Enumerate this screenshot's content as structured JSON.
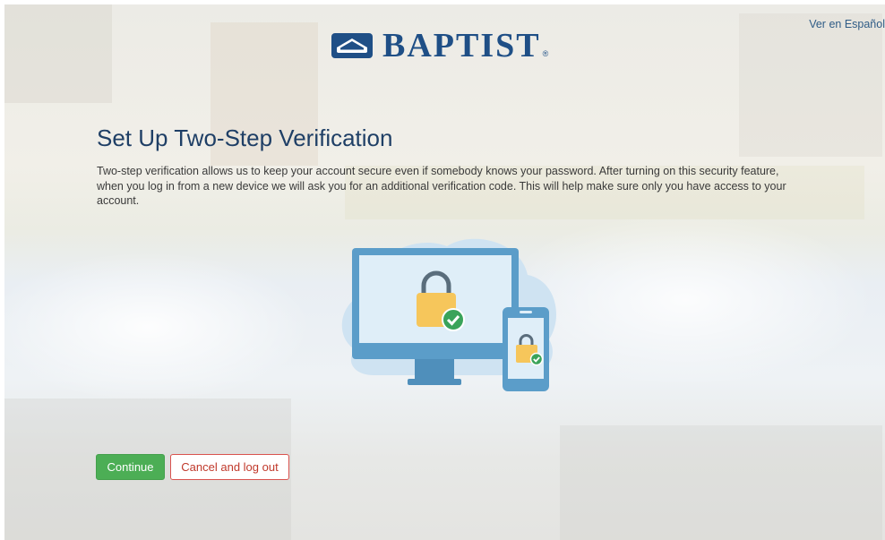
{
  "header": {
    "language_link": "Ver en Español",
    "logo_text": "BAPTIST",
    "logo_reg": "®"
  },
  "main": {
    "title": "Set Up Two-Step Verification",
    "description": "Two-step verification allows us to keep your account secure even if somebody knows your password. After turning on this security feature, when you log in from a new device we will ask you for an additional verification code. This will help make sure only you have access to your account."
  },
  "actions": {
    "continue_label": "Continue",
    "cancel_label": "Cancel and log out"
  },
  "colors": {
    "brand_blue": "#1f4f86",
    "title_color": "#1f3f66",
    "continue_green": "#4cae55",
    "cancel_red": "#c0392b",
    "illustration_blue": "#5b9dc9",
    "lock_yellow": "#f6c65b",
    "check_green": "#3aa35a"
  },
  "icons": {
    "logo": "baptist-logo-icon",
    "illustration": "secure-devices-illustration"
  }
}
